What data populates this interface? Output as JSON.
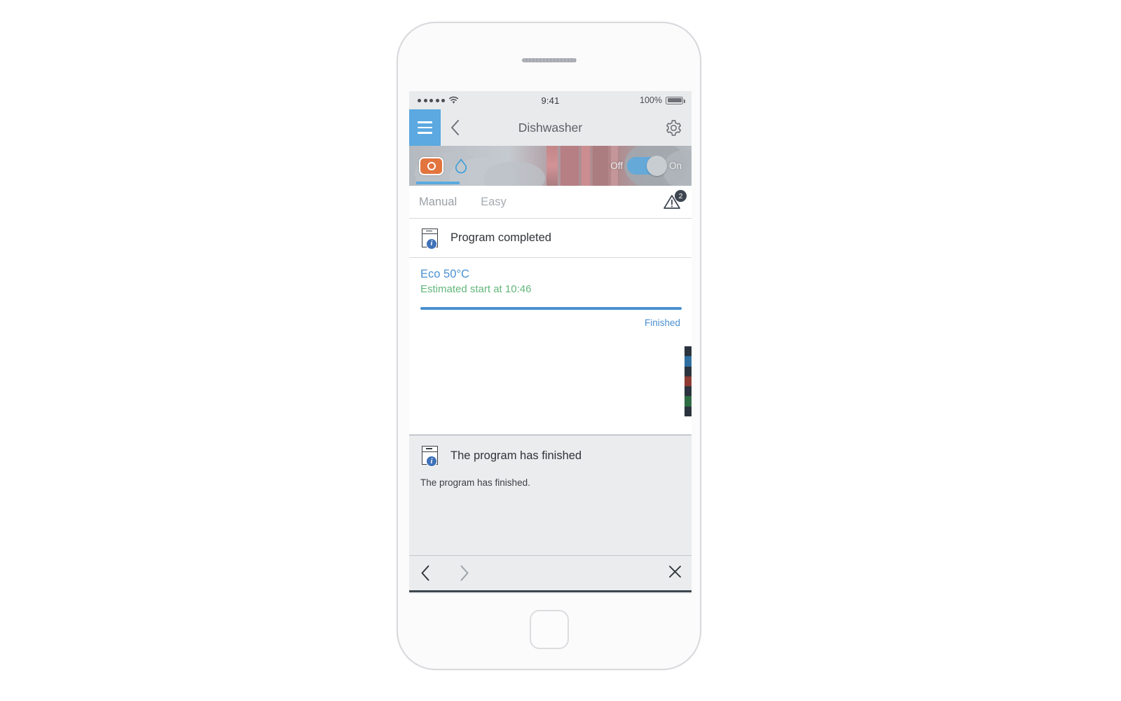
{
  "device": {
    "frame": "iphone-white",
    "home_button": "home-button"
  },
  "status_bar": {
    "signal_dots": 5,
    "wifi": "wifi-icon",
    "time": "9:41",
    "battery_percent": "100%",
    "battery_level": 100
  },
  "nav_bar": {
    "menu_icon": "hamburger-icon",
    "back_icon": "chevron-left-icon",
    "title": "Dishwasher",
    "settings_icon": "gear-icon",
    "menu_bg": "#5ba9e0"
  },
  "hero": {
    "program_icon": "dishwasher-program-icon",
    "program_icon_color": "#e2743e",
    "water_icon": "water-drop-icon",
    "water_icon_color": "#3e9fd8",
    "toggle": {
      "off_label": "Off",
      "on_label": "On",
      "state": "On",
      "track_color": "#5ba9e0"
    }
  },
  "tabs": {
    "items": [
      {
        "label": "Manual",
        "active": true
      },
      {
        "label": "Easy",
        "active": false
      }
    ],
    "warning": {
      "icon": "warning-triangle-icon",
      "count": "2",
      "badge_color": "#3e4650"
    }
  },
  "status_row": {
    "icon": "dishwasher-info-icon",
    "label": "Program completed"
  },
  "program": {
    "name": "Eco 50°C",
    "name_color": "#4a90d0",
    "estimate": "Estimated start at 10:46",
    "estimate_color": "#63b77b",
    "progress_percent": 100,
    "state_label": "Finished",
    "state_color": "#4a90d0"
  },
  "side_strip": {
    "name": "led-status-strip",
    "segments": [
      "#2b343e",
      "#2f6fa0",
      "#2b343e",
      "#8e3b32",
      "#2b343e",
      "#2f6b43",
      "#2b343e"
    ]
  },
  "message": {
    "icon": "dishwasher-info-icon",
    "title": "The program has finished",
    "body": "The program has finished."
  },
  "message_nav": {
    "prev_icon": "chevron-left-icon",
    "next_icon": "chevron-right-icon",
    "close_icon": "close-x-icon"
  },
  "footer": {
    "icon": "dishwasher-info-icon"
  }
}
